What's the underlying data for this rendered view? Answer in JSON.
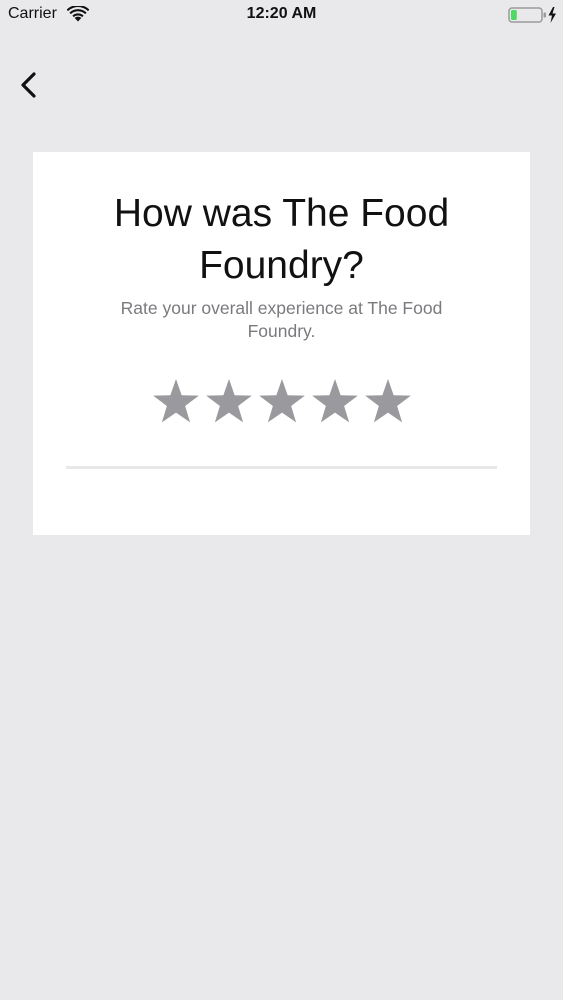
{
  "status_bar": {
    "carrier": "Carrier",
    "time": "12:20 AM",
    "wifi_icon": "wifi-icon",
    "battery_icon": "battery-charging-icon",
    "battery_level": 0.2,
    "battery_color": "#4cd964"
  },
  "navigation": {
    "back_icon": "chevron-left-icon"
  },
  "rating_card": {
    "title": "How was The Food Foundry?",
    "subtitle": "Rate your overall experience at The Food Foundry.",
    "stars": {
      "max": 5,
      "selected": 0,
      "icon": "star-icon",
      "color": "#9a9a9e"
    }
  }
}
